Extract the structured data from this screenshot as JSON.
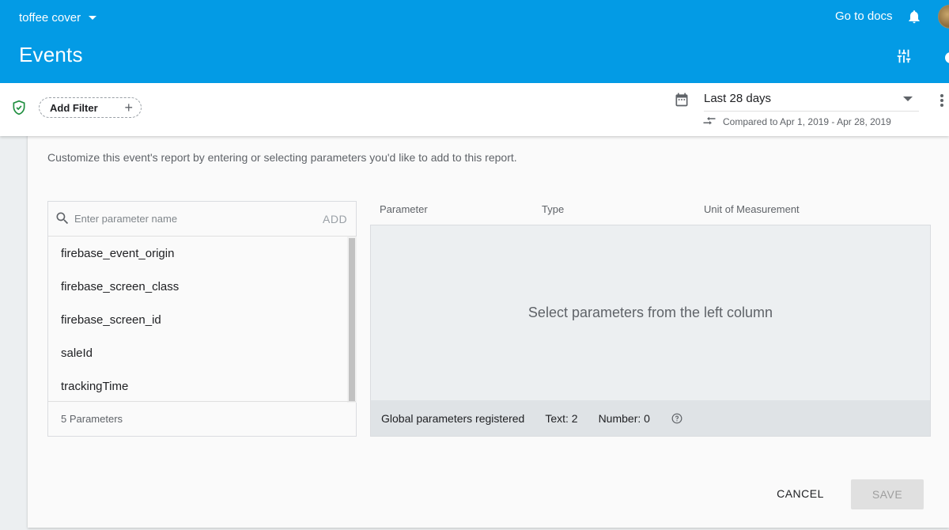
{
  "header": {
    "project_name": "toffee cover",
    "page_title": "Events",
    "docs_link": "Go to docs"
  },
  "filter_bar": {
    "add_filter_label": "Add Filter",
    "date_range": "Last 28 days",
    "compare_text": "Compared to Apr 1, 2019 - Apr 28, 2019"
  },
  "card": {
    "subtitle": "Customize this event's report by entering or selecting parameters you'd like to add to this report.",
    "search": {
      "placeholder": "Enter parameter name",
      "value": "",
      "add_label": "ADD"
    },
    "parameters": [
      "firebase_event_origin",
      "firebase_screen_class",
      "firebase_screen_id",
      "saleId",
      "trackingTime"
    ],
    "parameter_count": "5 Parameters",
    "columns": {
      "parameter": "Parameter",
      "type": "Type",
      "unit": "Unit of Measurement"
    },
    "empty_message": "Select parameters from the left column",
    "footer": {
      "global_label": "Global parameters registered",
      "text_count": "Text: 2",
      "number_count": "Number: 0"
    },
    "cancel_label": "CANCEL",
    "save_label": "SAVE"
  },
  "colors": {
    "header_bg": "#039be5",
    "shield_green": "#1e8e3e"
  }
}
